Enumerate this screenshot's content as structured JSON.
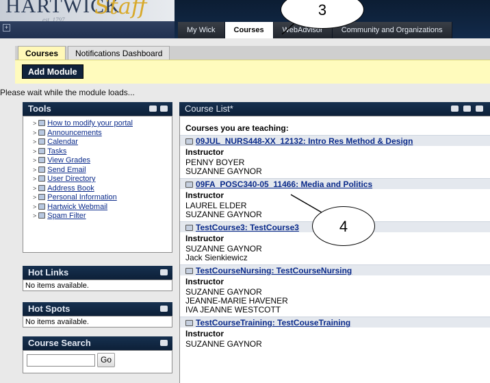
{
  "header": {
    "logo_text": "HARTWICK",
    "logo_staff": "Staff",
    "logo_est": "est. 1797",
    "nav_tabs": [
      {
        "label": "My Wick"
      },
      {
        "label": "Courses"
      },
      {
        "label": "WebAdvisor"
      },
      {
        "label": "Community and Organizations"
      }
    ]
  },
  "subtabs": [
    {
      "label": "Courses"
    },
    {
      "label": "Notifications Dashboard"
    }
  ],
  "add_module_label": "Add Module",
  "loading_text": "Please wait while the module loads...",
  "tools": {
    "title": "Tools",
    "items": [
      {
        "label": "How to modify your portal",
        "icon": "book-icon"
      },
      {
        "label": "Announcements",
        "icon": "megaphone-icon"
      },
      {
        "label": "Calendar",
        "icon": "calendar-icon"
      },
      {
        "label": "Tasks",
        "icon": "tasks-icon"
      },
      {
        "label": "View Grades",
        "icon": "grades-icon"
      },
      {
        "label": "Send Email",
        "icon": "envelope-icon"
      },
      {
        "label": "User Directory",
        "icon": "directory-icon"
      },
      {
        "label": "Address Book",
        "icon": "address-book-icon"
      },
      {
        "label": "Personal Information",
        "icon": "person-icon"
      },
      {
        "label": "Hartwick Webmail",
        "icon": "mail-icon"
      },
      {
        "label": "Spam Filter",
        "icon": "filter-icon"
      }
    ]
  },
  "hot_links": {
    "title": "Hot Links",
    "empty_text": "No items available."
  },
  "hot_spots": {
    "title": "Hot Spots",
    "empty_text": "No items available."
  },
  "course_search": {
    "title": "Course Search",
    "input_value": "",
    "button_label": "Go"
  },
  "course_list": {
    "title": "Course List*",
    "heading": "Courses you are teaching:",
    "instructor_label": "Instructor",
    "courses": [
      {
        "title": "09JUL_NURS448-XX_12132: Intro Res Method & Design",
        "instructors": [
          "PENNY BOYER",
          "SUZANNE GAYNOR"
        ]
      },
      {
        "title": "09FA_POSC340-05_11466: Media and Politics",
        "instructors": [
          "LAUREL ELDER",
          "SUZANNE GAYNOR"
        ]
      },
      {
        "title": "TestCourse3: TestCourse3",
        "instructors": [
          "SUZANNE GAYNOR",
          "Jack Sienkiewicz"
        ]
      },
      {
        "title": "TestCourseNursing: TestCourseNursing",
        "instructors": [
          "SUZANNE GAYNOR",
          "JEANNE-MARIE HAVENER",
          "IVA JEANNE WESTCOTT"
        ]
      },
      {
        "title": "TestCourseTraining: TestCouseTraining",
        "instructors": [
          "SUZANNE GAYNOR"
        ]
      }
    ]
  },
  "callouts": {
    "three": "3",
    "four": "4"
  }
}
